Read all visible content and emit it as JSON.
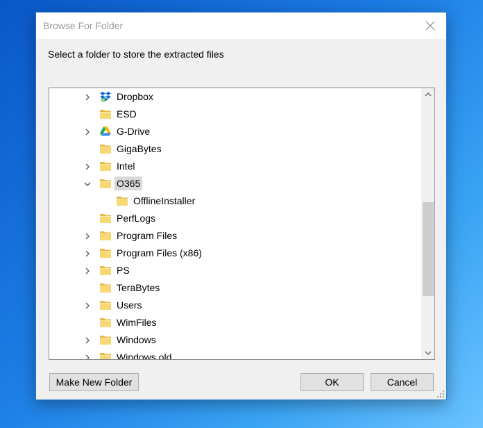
{
  "dialog": {
    "title": "Browse For Folder",
    "prompt": "Select a folder to store the extracted files"
  },
  "tree": {
    "items": [
      {
        "label": "Dropbox",
        "icon": "dropbox-icon",
        "expander": "collapsed",
        "selected": false
      },
      {
        "label": "ESD",
        "icon": "folder-icon",
        "expander": "none",
        "selected": false
      },
      {
        "label": "G-Drive",
        "icon": "google-drive-icon",
        "expander": "collapsed",
        "selected": false
      },
      {
        "label": "GigaBytes",
        "icon": "folder-icon",
        "expander": "none",
        "selected": false
      },
      {
        "label": "Intel",
        "icon": "folder-icon",
        "expander": "collapsed",
        "selected": false
      },
      {
        "label": "O365",
        "icon": "folder-icon",
        "expander": "expanded",
        "selected": true
      },
      {
        "label": "OfflineInstaller",
        "icon": "folder-icon",
        "expander": "none",
        "selected": false,
        "child": true
      },
      {
        "label": "PerfLogs",
        "icon": "folder-icon",
        "expander": "none",
        "selected": false
      },
      {
        "label": "Program Files",
        "icon": "folder-icon",
        "expander": "collapsed",
        "selected": false
      },
      {
        "label": "Program Files (x86)",
        "icon": "folder-icon",
        "expander": "collapsed",
        "selected": false
      },
      {
        "label": "PS",
        "icon": "folder-icon",
        "expander": "collapsed",
        "selected": false
      },
      {
        "label": "TeraBytes",
        "icon": "folder-icon",
        "expander": "none",
        "selected": false
      },
      {
        "label": "Users",
        "icon": "folder-icon",
        "expander": "collapsed",
        "selected": false
      },
      {
        "label": "WimFiles",
        "icon": "folder-icon",
        "expander": "none",
        "selected": false
      },
      {
        "label": "Windows",
        "icon": "folder-icon",
        "expander": "collapsed",
        "selected": false
      },
      {
        "label": "Windows.old",
        "icon": "folder-icon",
        "expander": "collapsed",
        "selected": false
      }
    ]
  },
  "buttons": {
    "new_folder": "Make New Folder",
    "ok": "OK",
    "cancel": "Cancel"
  },
  "colors": {
    "folder": "#f8d775",
    "folder_dark": "#e6b94a",
    "selection": "#d9d9d9",
    "accent": "#1a76d2"
  }
}
